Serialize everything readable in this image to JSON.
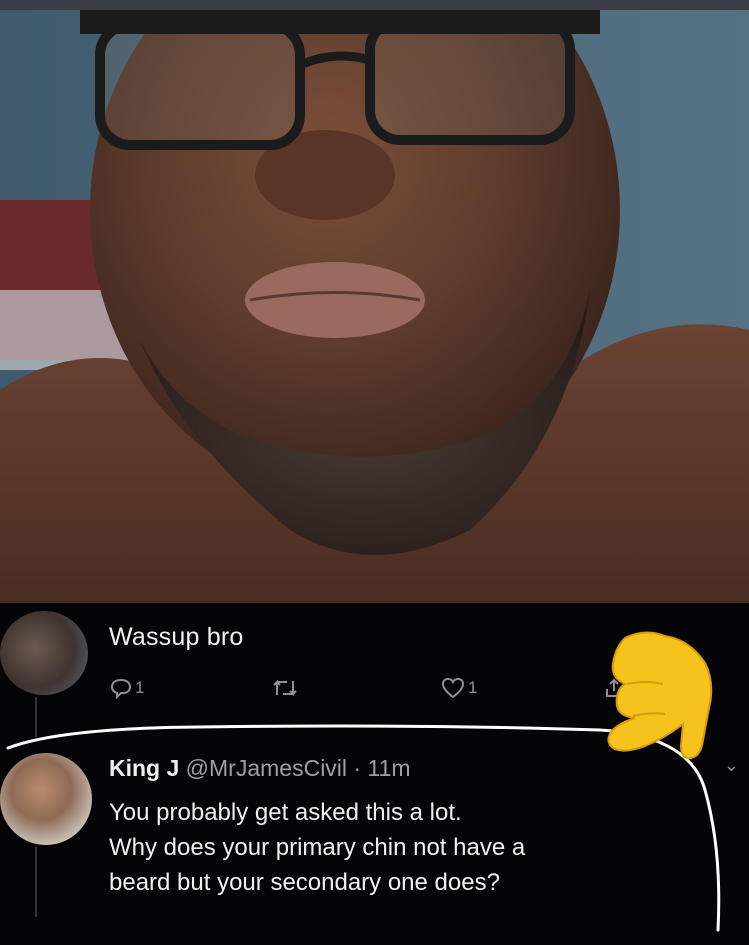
{
  "tweet_1": {
    "text": "Wassup bro",
    "reply_count": "1",
    "like_count": "1"
  },
  "tweet_2": {
    "name": "King J",
    "handle": "@MrJamesCivil",
    "separator": "·",
    "time": "11m",
    "lines": [
      "You probably get asked this a lot.",
      "Why does your primary chin not have a",
      "beard but your secondary one does?"
    ]
  },
  "icons": {
    "reply": "reply-icon",
    "retweet": "retweet-icon",
    "like": "heart-icon",
    "share": "share-icon",
    "pointer": "pointing-hand-emoji-icon",
    "more": "chevron-down-icon"
  },
  "colors": {
    "background": "#050507",
    "text": "#f0f0f0",
    "muted": "#8b9198",
    "emoji": "#f6c21c"
  }
}
